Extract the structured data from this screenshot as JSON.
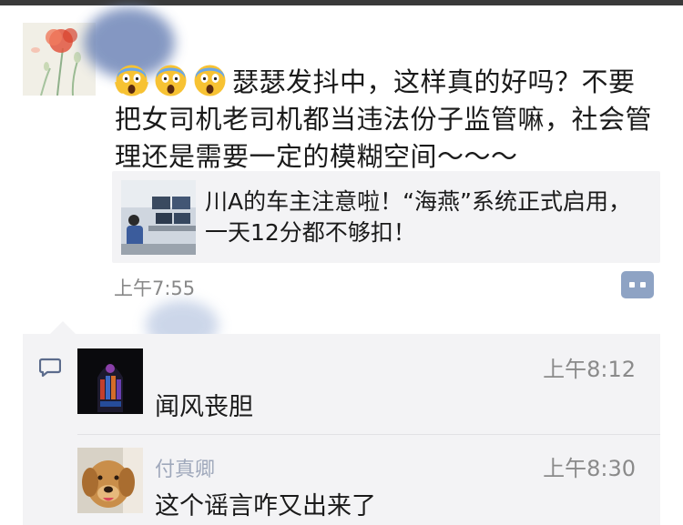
{
  "post": {
    "text_after_emoji": "瑟瑟发抖中，这样真的好吗？不要把女司机老司机都当违法份子监管嘛，社会管理还是需要一定的模糊空间～～～",
    "emojis": [
      "scream-emoji",
      "scream-emoji",
      "scream-emoji"
    ],
    "link_title": "川A的车主注意啦！“海燕”系统正式启用，一天12分都不够扣！",
    "time": "上午7:55"
  },
  "comments": [
    {
      "name": "",
      "time": "上午8:12",
      "text": "闻风丧胆"
    },
    {
      "name": "付真卿",
      "time": "上午8:30",
      "text": "这个谣言咋又出来了"
    }
  ],
  "colors": {
    "link_blue": "#5b6b8c",
    "more_button": "#8ea3c4",
    "panel_bg": "#f3f3f5",
    "time_gray": "#888888"
  },
  "icons": {
    "more": "more-dots-icon",
    "comment": "comment-bubble-icon"
  }
}
